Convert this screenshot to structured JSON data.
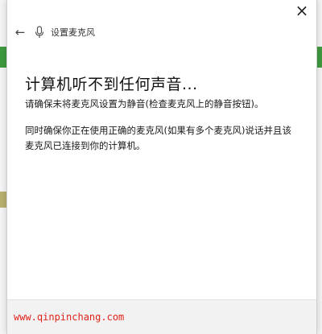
{
  "dialog": {
    "close_label": "×",
    "header": {
      "back_label": "←",
      "title": "设置麦克风"
    },
    "title": "计算机听不到任何声音...",
    "paragraphs": [
      "请确保未将麦克风设置为静音(检查麦克风上的静音按钮)。",
      "同时确保你正在使用正确的麦克风(如果有多个麦克风)说话并且该麦克风已连接到你的计算机。"
    ]
  },
  "watermark": "www.qinpinchang.com",
  "colors": {
    "watermark": "#e0241b",
    "backdrop_green": "#3f9a3f",
    "accent_blue": "#2a6fd6"
  },
  "icons": {
    "close": "close-icon",
    "back": "back-arrow-icon",
    "mic": "microphone-icon"
  }
}
